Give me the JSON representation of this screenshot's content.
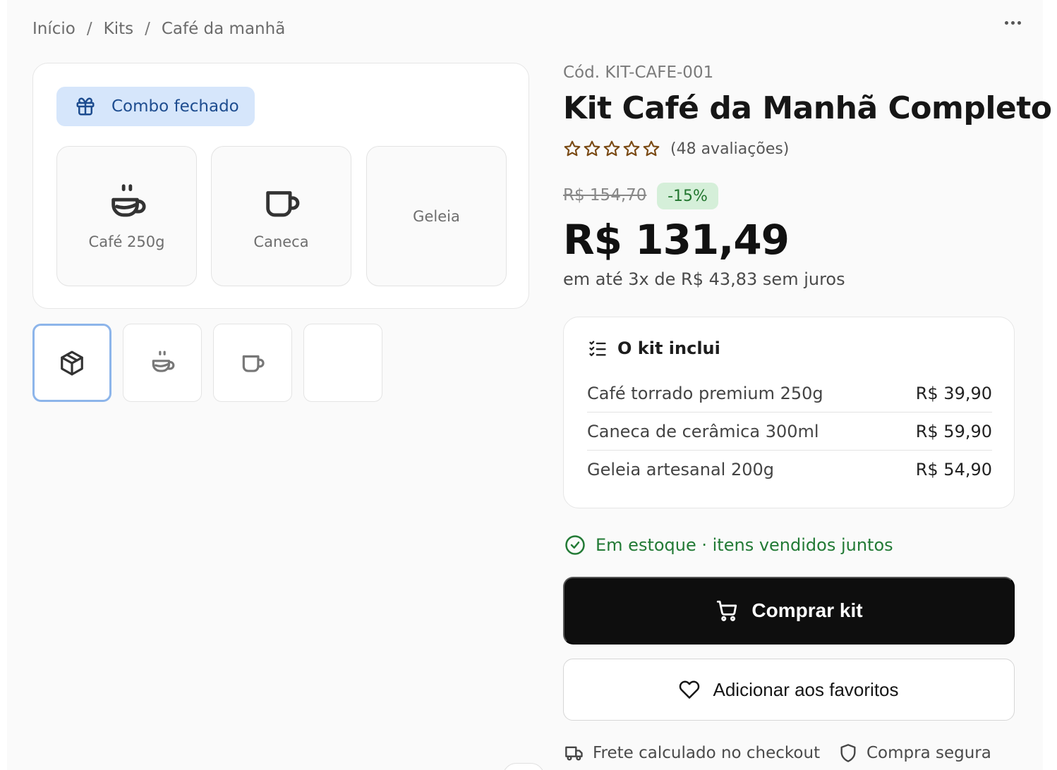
{
  "breadcrumb": {
    "items": [
      "Início",
      "Kits",
      "Café da manhã"
    ],
    "separator": "/"
  },
  "menu": {
    "more_icon": "more-horizontal-icon"
  },
  "gallery": {
    "badge": {
      "label": "Combo fechado",
      "icon": "gift-icon"
    },
    "tiles": [
      {
        "label": "Café 250g",
        "icon": "coffee-cup-icon"
      },
      {
        "label": "Caneca",
        "icon": "mug-icon"
      },
      {
        "label": "Geleia",
        "icon": ""
      }
    ],
    "thumbnails": [
      {
        "icon": "package-icon",
        "active": true
      },
      {
        "icon": "coffee-cup-icon",
        "active": false
      },
      {
        "icon": "mug-icon",
        "active": false
      },
      {
        "icon": "",
        "active": false
      }
    ]
  },
  "product": {
    "sku": "Cód. KIT-CAFE-001",
    "title": "Kit Café da Manhã Completo",
    "rating": {
      "stars": 0,
      "max_stars": 5,
      "count_text": "(48 avaliações)"
    },
    "old_price": "R$ 154,70",
    "discount": "-15%",
    "price": "R$ 131,49",
    "installments": "em até 3x de R$ 43,83 sem juros"
  },
  "kit": {
    "heading": "O kit inclui",
    "items": [
      {
        "name": "Café torrado premium 250g",
        "price": "R$ 39,90"
      },
      {
        "name": "Caneca de cerâmica 300ml",
        "price": "R$ 59,90"
      },
      {
        "name": "Geleia artesanal 200g",
        "price": "R$ 54,90"
      }
    ]
  },
  "stock": {
    "text": "Em estoque · itens vendidos juntos"
  },
  "actions": {
    "buy_label": "Comprar kit",
    "favorite_label": "Adicionar aos favoritos"
  },
  "footer_info": {
    "shipping": "Frete calculado no checkout",
    "secure": "Compra segura"
  },
  "colors": {
    "accent_blue": "#d6e6fb",
    "badge_text": "#1d4c8f",
    "success_green": "#227a35",
    "discount_bg": "#d5efd9",
    "star_brown": "#7a4a14",
    "primary_button": "#0e0e0e"
  }
}
